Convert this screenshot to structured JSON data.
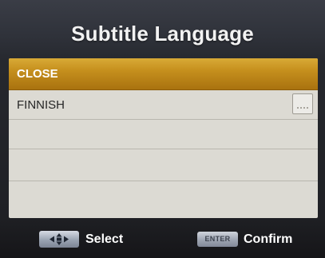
{
  "dialog": {
    "title": "Subtitle Language"
  },
  "list": {
    "items": [
      {
        "label": "CLOSE",
        "selected": true
      },
      {
        "label": "FINNISH",
        "selected": false,
        "icon": "subtitle-track-icon"
      },
      {
        "label": "",
        "selected": false
      },
      {
        "label": "",
        "selected": false
      },
      {
        "label": "",
        "selected": false
      }
    ]
  },
  "footer": {
    "select_key_icon": "directional-pad-icon",
    "select_label": "Select",
    "enter_key_label": "ENTER",
    "confirm_label": "Confirm"
  },
  "colors": {
    "selection": "#c58f1d",
    "list_background": "#dcdad3",
    "title_text": "#f2f2f2"
  }
}
